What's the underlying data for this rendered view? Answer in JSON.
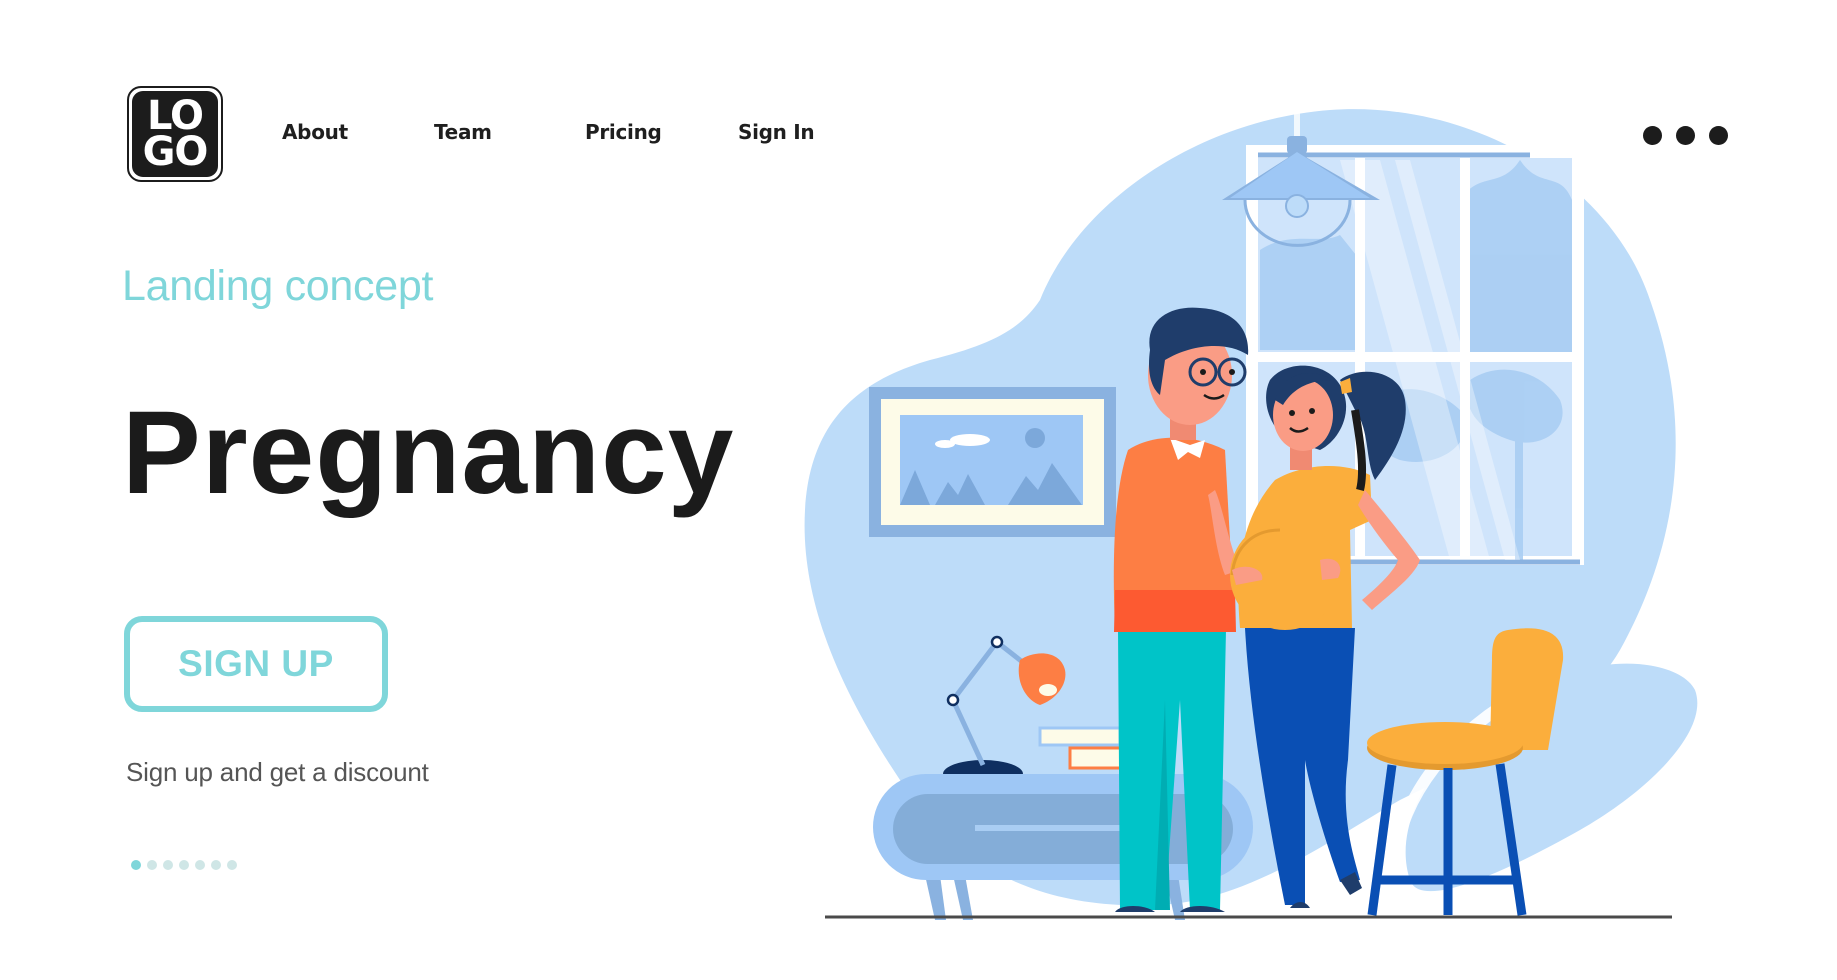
{
  "header": {
    "logo": {
      "line1": "LO",
      "line2": "GO"
    },
    "nav": [
      {
        "label": "About"
      },
      {
        "label": "Team"
      },
      {
        "label": "Pricing"
      },
      {
        "label": "Sign In"
      }
    ],
    "more_menu_icon": "more-horizontal-icon"
  },
  "hero": {
    "subtitle": "Landing concept",
    "title": "Pregnancy",
    "cta_label": "SIGN UP",
    "caption": "Sign up and get a discount"
  },
  "carousel": {
    "total": 7,
    "active_index": 0
  },
  "illustration": {
    "description": "Couple expecting a baby in a living room with window, framed picture, desk lamp, books, cabinet and yellow chair"
  },
  "colors": {
    "accent": "#7fd6da",
    "text_dark": "#1b1b1b",
    "text_muted": "#555555",
    "blob_light": "#bddcf9",
    "blob_mid": "#8ab2e0",
    "orange": "#fd7e44",
    "yellow": "#fbae3c",
    "teal": "#00c4c8",
    "blue_dark": "#0a4fb4",
    "navy": "#1f3d6b"
  }
}
